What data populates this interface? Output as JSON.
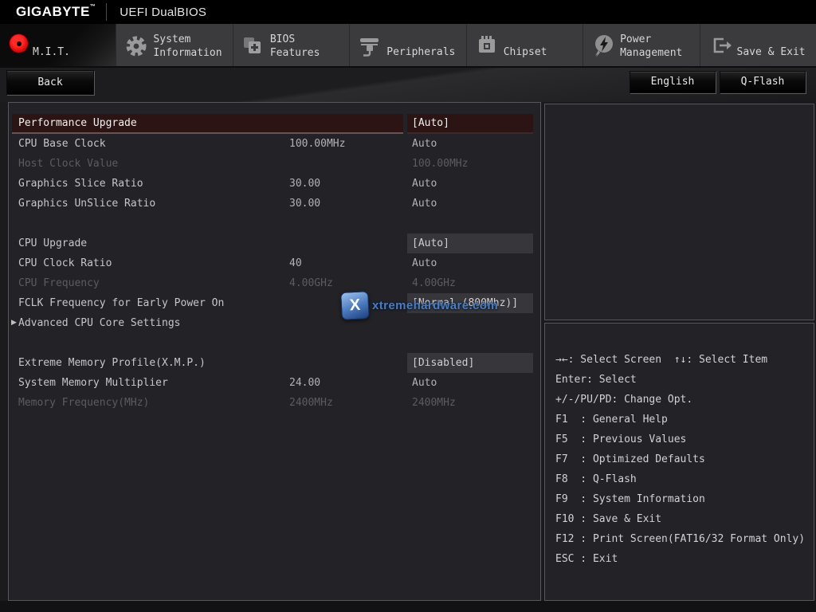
{
  "header": {
    "brand": "GIGABYTE",
    "trademark": "™",
    "title": "UEFI DualBIOS"
  },
  "tabs": {
    "mit": {
      "label": "M.I.T."
    },
    "system_information": {
      "line1": "System",
      "line2": "Information"
    },
    "bios_features": {
      "line1": "BIOS",
      "line2": "Features"
    },
    "peripherals": {
      "label": "Peripherals"
    },
    "chipset": {
      "label": "Chipset"
    },
    "power_management": {
      "line1": "Power",
      "line2": "Management"
    },
    "save_exit": {
      "label": "Save & Exit"
    }
  },
  "toolbar": {
    "back_label": "Back",
    "language_label": "English",
    "qflash_label": "Q-Flash"
  },
  "settings": {
    "rows": [
      {
        "label": "Performance Upgrade",
        "mid": "",
        "value": "[Auto]",
        "style": "highlight"
      },
      {
        "label": "CPU Base Clock",
        "mid": "100.00MHz",
        "value": "Auto",
        "style": "normal"
      },
      {
        "label": "Host Clock Value",
        "mid": "",
        "value": "100.00MHz",
        "style": "disabled"
      },
      {
        "label": "Graphics Slice Ratio",
        "mid": "30.00",
        "value": "Auto",
        "style": "normal"
      },
      {
        "label": "Graphics UnSlice Ratio",
        "mid": "30.00",
        "value": "Auto",
        "style": "normal"
      },
      {
        "spacer": true
      },
      {
        "label": "CPU Upgrade",
        "mid": "",
        "value": "[Auto]",
        "style": "boxed"
      },
      {
        "label": "CPU Clock Ratio",
        "mid": "40",
        "value": "Auto",
        "style": "normal"
      },
      {
        "label": "CPU Frequency",
        "mid": "4.00GHz",
        "value": "4.00GHz",
        "style": "disabled"
      },
      {
        "label": "FCLK Frequency for Early Power On",
        "mid": "",
        "value": "[Normal (800Mhz)]",
        "style": "boxed"
      },
      {
        "label": "Advanced CPU Core Settings",
        "mid": "",
        "value": "",
        "style": "normal",
        "arrow": true
      },
      {
        "spacer": true
      },
      {
        "label": "Extreme Memory Profile(X.M.P.)",
        "mid": "",
        "value": "[Disabled]",
        "style": "boxed"
      },
      {
        "label": "System Memory Multiplier",
        "mid": "24.00",
        "value": "Auto",
        "style": "normal"
      },
      {
        "label": "Memory Frequency(MHz)",
        "mid": "2400MHz",
        "value": "2400MHz",
        "style": "disabled"
      }
    ]
  },
  "help_panel": {
    "lines": [
      "→←: Select Screen  ↑↓: Select Item",
      "Enter: Select",
      "+/-/PU/PD: Change Opt.",
      "F1  : General Help",
      "F5  : Previous Values",
      "F7  : Optimized Defaults",
      "F8  : Q-Flash",
      "F9  : System Information",
      "F10 : Save & Exit",
      "F12 : Print Screen(FAT16/32 Format Only)",
      "ESC : Exit"
    ]
  },
  "watermark": {
    "icon_letter": "X",
    "text": "xtremehardware.com"
  },
  "colors": {
    "accent_red": "#e00d0d",
    "highlight_bg": "#2c1414",
    "boxed_value_bg": "#37373b",
    "panel_bg": "#232327",
    "tab_bg": "#3b3b3e"
  }
}
